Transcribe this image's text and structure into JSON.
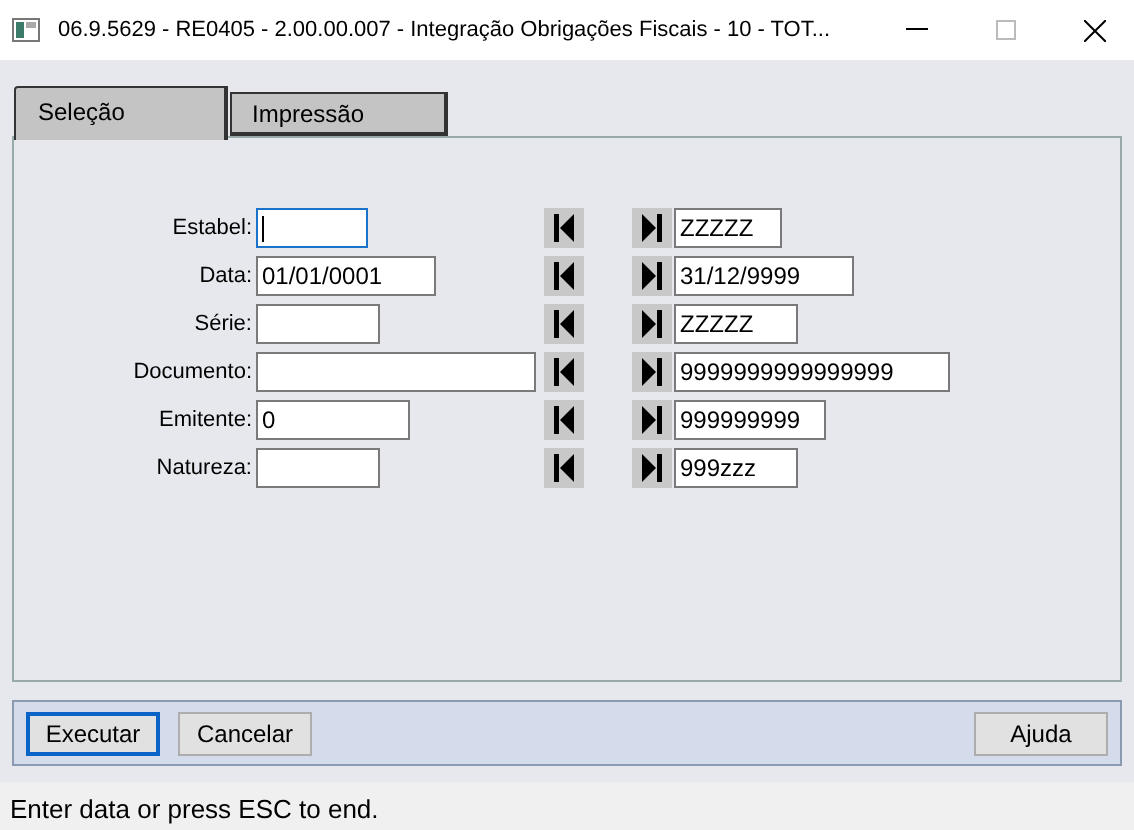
{
  "window": {
    "title": "06.9.5629 - RE0405 - 2.00.00.007 - Integração Obrigações Fiscais - 10 - TOT..."
  },
  "tabs": [
    {
      "label": "Seleção",
      "selected": true
    },
    {
      "label": "Impressão",
      "selected": false
    }
  ],
  "fields": [
    {
      "label": "Estabel:",
      "to": "ZZZZZ",
      "focused": true
    },
    {
      "label": "Data:",
      "from": "01/01/0001",
      "to": "31/12/9999",
      "focused": false
    },
    {
      "label": "Série:",
      "to": "ZZZZZ",
      "focused": false
    },
    {
      "label": "Documento:",
      "to": "9999999999999999",
      "focused": false
    },
    {
      "label": "Emitente:",
      "from": "0",
      "to": "999999999",
      "focused": false
    },
    {
      "label": "Natureza:",
      "to": "999zzz",
      "focused": false
    }
  ],
  "buttons": [
    {
      "label": "Executar",
      "default": true
    },
    {
      "label": "Cancelar",
      "default": false
    }
  ],
  "help_button": "Ajuda",
  "status_bar": "Enter data or press ESC to end."
}
